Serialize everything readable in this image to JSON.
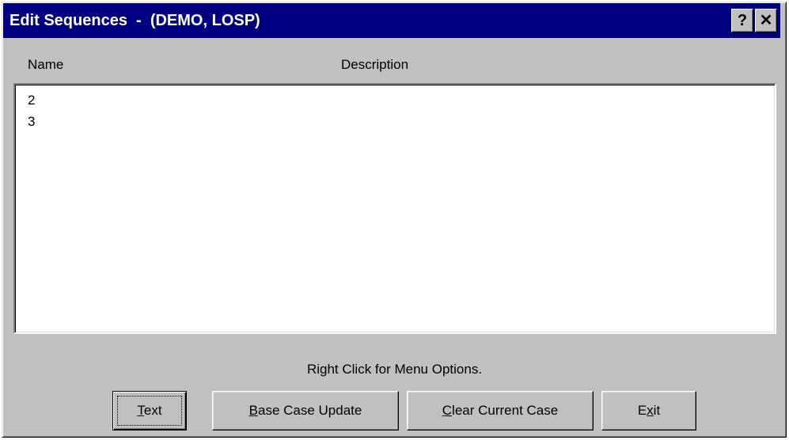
{
  "window": {
    "title": "Edit Sequences  -  (DEMO, LOSP)",
    "help_label": "?",
    "close_label": "✕"
  },
  "columns": {
    "name": "Name",
    "description": "Description"
  },
  "list": {
    "items": [
      {
        "name": "2",
        "description": ""
      },
      {
        "name": "3",
        "description": ""
      }
    ]
  },
  "hint": "Right Click for Menu Options.",
  "buttons": {
    "text": {
      "mnemonic": "T",
      "rest": "ext"
    },
    "base": {
      "mnemonic": "B",
      "rest": "ase Case Update"
    },
    "clear": {
      "mnemonic": "C",
      "rest": "lear Current Case"
    },
    "exit": {
      "pre": "E",
      "mnemonic": "x",
      "rest": "it"
    }
  },
  "colors": {
    "titlebar": "#000080",
    "face": "#c0c0c0"
  }
}
